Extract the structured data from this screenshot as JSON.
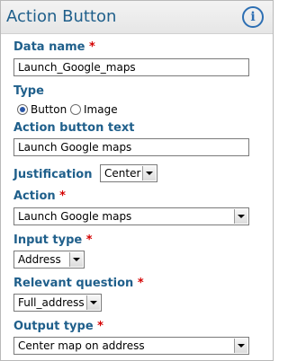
{
  "header": {
    "title": "Action Button",
    "info_icon": "info-icon"
  },
  "fields": {
    "data_name": {
      "label": "Data name",
      "required": "*",
      "value": "Launch_Google_maps"
    },
    "type": {
      "label": "Type",
      "options": [
        {
          "label": "Button",
          "selected": true
        },
        {
          "label": "Image",
          "selected": false
        }
      ]
    },
    "action_button_text": {
      "label": "Action button text",
      "value": "Launch Google maps"
    },
    "justification": {
      "label": "Justification",
      "value": "Center"
    },
    "action": {
      "label": "Action",
      "required": "*",
      "value": "Launch Google maps"
    },
    "input_type": {
      "label": "Input type",
      "required": "*",
      "value": "Address"
    },
    "relevant_question": {
      "label": "Relevant question",
      "required": "*",
      "value": "Full_address"
    },
    "output_type": {
      "label": "Output type",
      "required": "*",
      "value": "Center map on address"
    }
  },
  "colors": {
    "label": "#1f5f8b",
    "required": "#d40000",
    "radio_selected": "#2a57a7",
    "info": "#2d6fb3"
  }
}
